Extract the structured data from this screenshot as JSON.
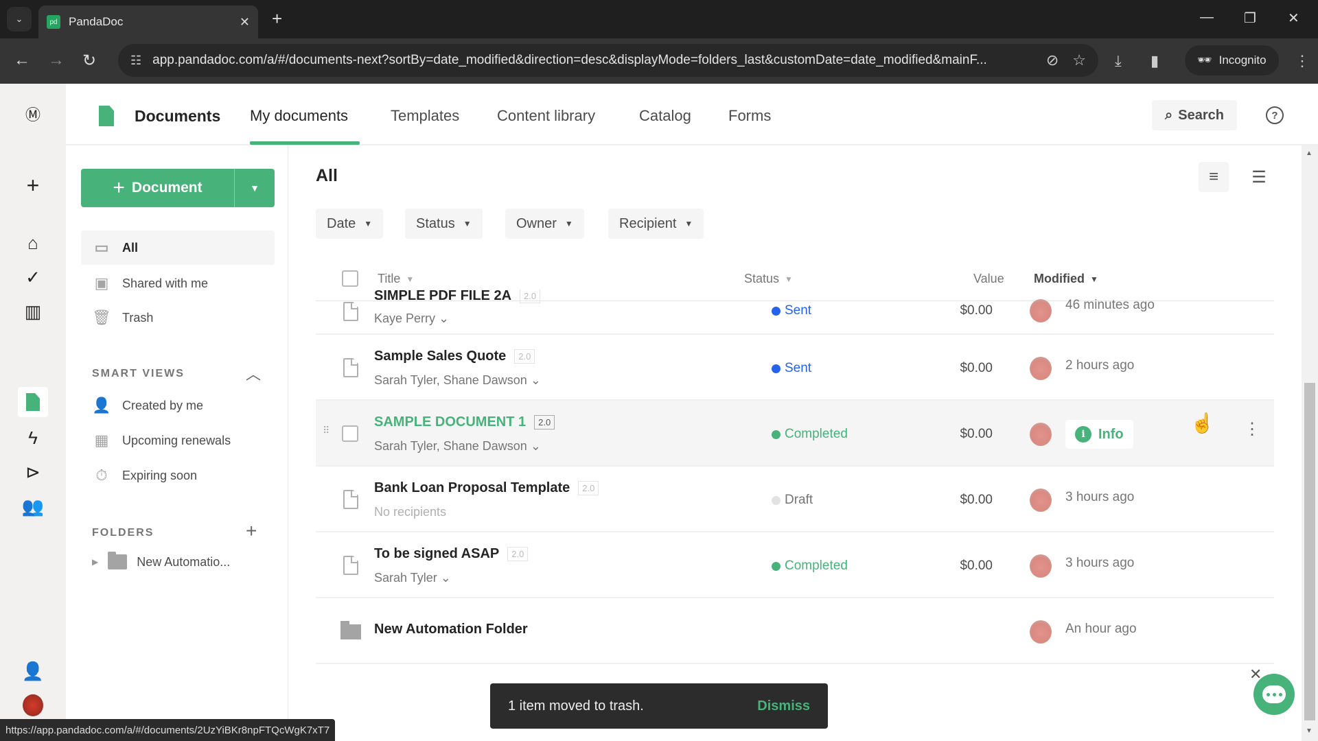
{
  "browser": {
    "tab_title": "PandaDoc",
    "favicon_text": "pd",
    "url": "app.pandadoc.com/a/#/documents-next?sortBy=date_modified&direction=desc&displayMode=folders_last&customDate=date_modified&mainF...",
    "incognito_label": "Incognito",
    "status_url": "https://app.pandadoc.com/a/#/documents/2UzYiBKr8npFTQcWgK7xT7"
  },
  "topnav": {
    "title": "Documents",
    "tabs": [
      "My documents",
      "Templates",
      "Content library",
      "Catalog",
      "Forms"
    ],
    "active_tab": "My documents",
    "search_label": "Search",
    "help_label": "?"
  },
  "left_panel": {
    "new_button_label": "Document",
    "items": [
      "All",
      "Shared with me",
      "Trash"
    ],
    "smart_views_label": "SMART VIEWS",
    "smart_views": [
      "Created by me",
      "Upcoming renewals",
      "Expiring soon"
    ],
    "folders_label": "FOLDERS",
    "folders": [
      "New Automatio..."
    ]
  },
  "main": {
    "title": "All",
    "filters": [
      "Date",
      "Status",
      "Owner",
      "Recipient"
    ],
    "columns": {
      "title": "Title",
      "status": "Status",
      "value": "Value",
      "modified": "Modified"
    },
    "rows": [
      {
        "title": "SIMPLE PDF FILE 2A",
        "version": "2.0",
        "recipients": "Kaye Perry",
        "status": "Sent",
        "value": "$0.00",
        "modified": "46 minutes ago"
      },
      {
        "title": "Sample Sales Quote",
        "version": "2.0",
        "recipients": "Sarah Tyler, Shane Dawson",
        "status": "Sent",
        "value": "$0.00",
        "modified": "2 hours ago"
      },
      {
        "title": "SAMPLE DOCUMENT 1",
        "version": "2.0",
        "recipients": "Sarah Tyler, Shane Dawson",
        "status": "Completed",
        "value": "$0.00",
        "info_label": "Info"
      },
      {
        "title": "Bank Loan Proposal Template",
        "version": "2.0",
        "recipients": "No recipients",
        "status": "Draft",
        "value": "$0.00",
        "modified": "3 hours ago"
      },
      {
        "title": "To be signed ASAP",
        "version": "2.0",
        "recipients": "Sarah Tyler",
        "status": "Completed",
        "value": "$0.00",
        "modified": "3 hours ago"
      },
      {
        "title": "New Automation Folder",
        "modified": "An hour ago"
      }
    ]
  },
  "toast": {
    "message": "1 item moved to trash.",
    "action": "Dismiss"
  },
  "colors": {
    "brand": "#47b27a",
    "sent": "#2563eb",
    "completed": "#47b27a",
    "draft": "#d9d9d9"
  }
}
